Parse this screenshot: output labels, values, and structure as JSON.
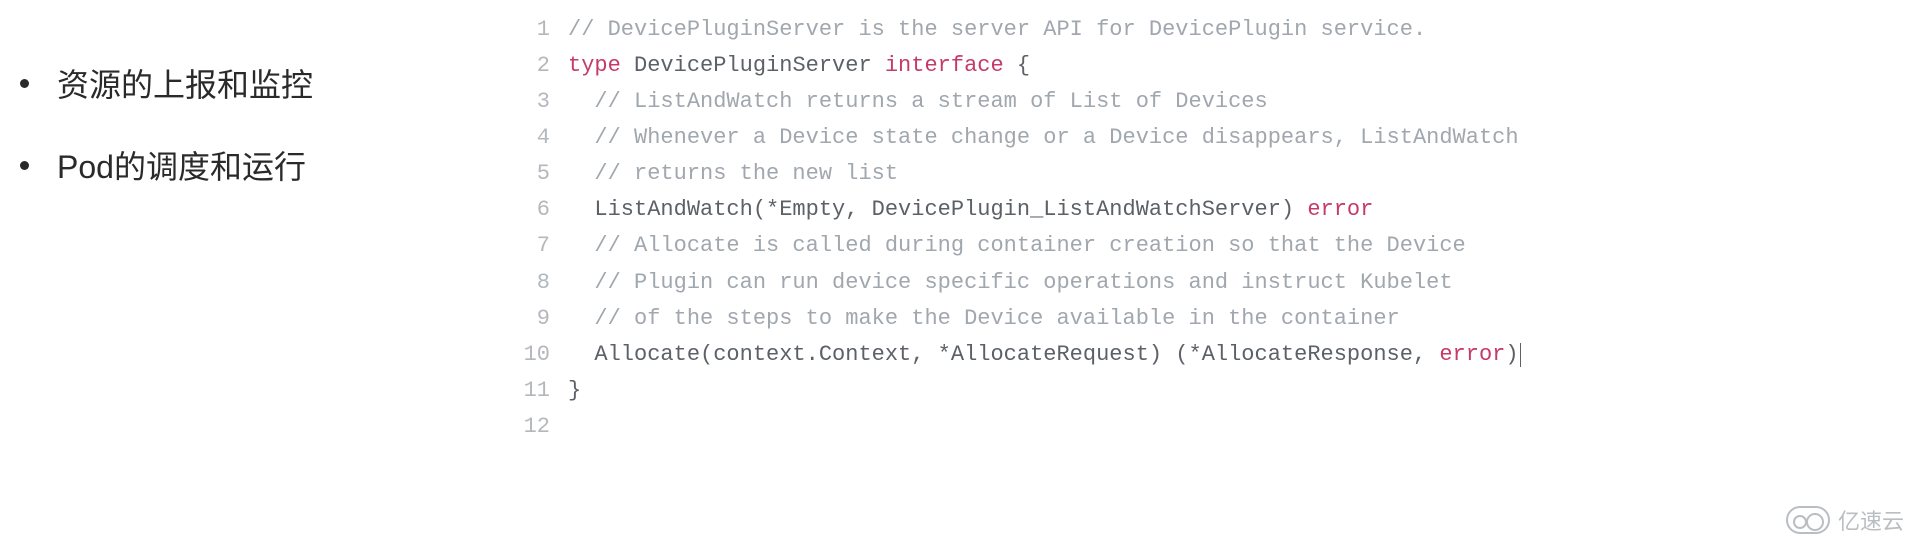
{
  "bullets": [
    "资源的上报和监控",
    "Pod的调度和运行"
  ],
  "code": {
    "lines": [
      {
        "n": 1,
        "tokens": [
          {
            "t": "// DevicePluginServer is the server API for DevicePlugin service.",
            "c": "cmt"
          }
        ]
      },
      {
        "n": 2,
        "tokens": [
          {
            "t": "type",
            "c": "kw"
          },
          {
            "t": " DevicePluginServer ",
            "c": "typ"
          },
          {
            "t": "interface",
            "c": "kw"
          },
          {
            "t": " {",
            "c": "typ"
          }
        ]
      },
      {
        "n": 3,
        "tokens": [
          {
            "t": "  // ListAndWatch returns a stream of List of Devices",
            "c": "cmt"
          }
        ]
      },
      {
        "n": 4,
        "tokens": [
          {
            "t": "  // Whenever a Device state change or a Device disappears, ListAndWatch",
            "c": "cmt"
          }
        ]
      },
      {
        "n": 5,
        "tokens": [
          {
            "t": "  // returns the new list",
            "c": "cmt"
          }
        ]
      },
      {
        "n": 6,
        "tokens": [
          {
            "t": "  ListAndWatch(*Empty, DevicePlugin_ListAndWatchServer) ",
            "c": "typ"
          },
          {
            "t": "error",
            "c": "err"
          }
        ]
      },
      {
        "n": 7,
        "tokens": [
          {
            "t": "  // Allocate is called during container creation so that the Device",
            "c": "cmt"
          }
        ]
      },
      {
        "n": 8,
        "tokens": [
          {
            "t": "  // Plugin can run device specific operations and instruct Kubelet",
            "c": "cmt"
          }
        ]
      },
      {
        "n": 9,
        "tokens": [
          {
            "t": "  // of the steps to make the Device available in the container",
            "c": "cmt"
          }
        ]
      },
      {
        "n": 10,
        "tokens": [
          {
            "t": "  Allocate(context.Context, *AllocateRequest) (*AllocateResponse, ",
            "c": "typ"
          },
          {
            "t": "error",
            "c": "err"
          },
          {
            "t": ")",
            "c": "typ"
          }
        ],
        "cursor": true
      },
      {
        "n": 11,
        "tokens": [
          {
            "t": "}",
            "c": "typ"
          }
        ]
      },
      {
        "n": 12,
        "tokens": [
          {
            "t": "",
            "c": "typ"
          }
        ]
      }
    ]
  },
  "watermark": "亿速云"
}
